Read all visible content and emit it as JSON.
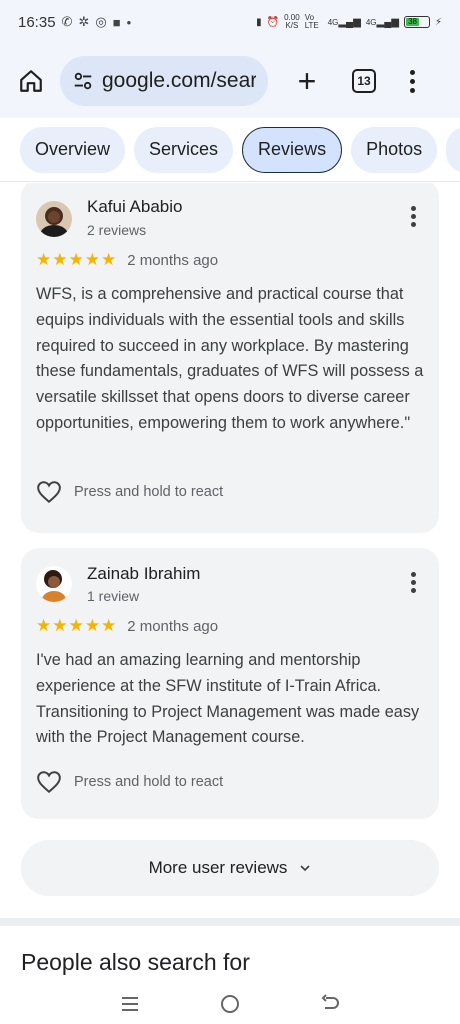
{
  "status_bar": {
    "time": "16:35",
    "network_speed": "0.00",
    "network_unit": "K/S",
    "volte": "Vo LTE",
    "signal_1": "4G",
    "signal_2": "4G",
    "battery_level": "38"
  },
  "browser": {
    "url": "google.com/search",
    "tab_count": "13",
    "icons": [
      "home-icon",
      "tune-icon",
      "plus-icon",
      "tabs-icon",
      "more-vert-icon"
    ]
  },
  "tabs": [
    {
      "label": "Overview",
      "active": false
    },
    {
      "label": "Services",
      "active": false
    },
    {
      "label": "Reviews",
      "active": true
    },
    {
      "label": "Photos",
      "active": false
    }
  ],
  "reviews": [
    {
      "name": "Kafui Ababio",
      "count": "2 reviews",
      "stars": "★★★★★",
      "rating": 5,
      "time": "2 months ago",
      "text": "WFS, is a comprehensive and practical course that equips individuals with the essential tools and skills required to succeed in any workplace. By mastering these fundamentals, graduates of WFS will possess a versatile skillsset that opens doors to diverse career opportunities, empowering them to work anywhere.\"",
      "react_label": "Press and hold to react"
    },
    {
      "name": "Zainab Ibrahim",
      "count": "1 review",
      "stars": "★★★★★",
      "rating": 5,
      "time": "2 months ago",
      "text": "I've had an amazing learning and mentorship experience at the SFW institute of I-Train Africa. Transitioning to Project Management was made easy with the Project Management course.",
      "react_label": "Press and hold to react"
    }
  ],
  "more_reviews_label": "More user reviews",
  "section_title": "People also search for",
  "colors": {
    "star": "#f4b400",
    "card_bg": "#f1f3f4",
    "chip_bg": "#e8effa",
    "chip_active_bg": "#d3e3fd"
  }
}
